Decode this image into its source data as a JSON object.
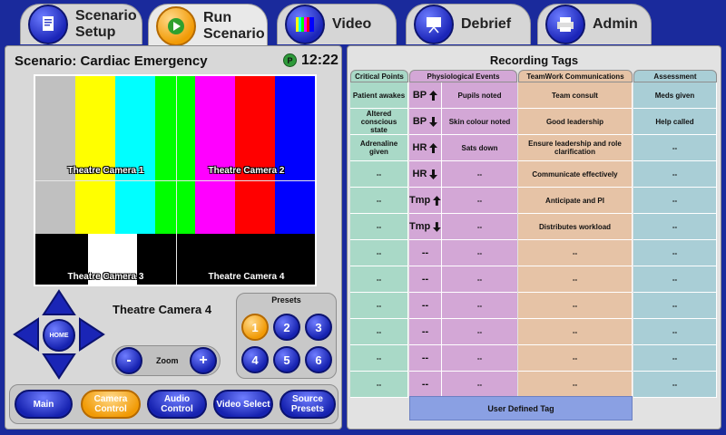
{
  "tabs": [
    {
      "line1": "Scenario",
      "line2": "Setup",
      "icon": "document-icon",
      "active": false
    },
    {
      "line1": "Run",
      "line2": "Scenario",
      "icon": "play-icon",
      "active": true
    },
    {
      "line1": "Video",
      "line2": "",
      "icon": "color-bars-icon",
      "active": false
    },
    {
      "line1": "Debrief",
      "line2": "",
      "icon": "projector-screen-icon",
      "active": false
    },
    {
      "line1": "Admin",
      "line2": "",
      "icon": "printer-icon",
      "active": false
    }
  ],
  "scenario": {
    "title": "Scenario: Cardiac Emergency",
    "badge": "P",
    "clock": "12:22"
  },
  "video": {
    "camera_labels": [
      "Theatre Camera 1",
      "Theatre Camera 2",
      "Theatre Camera 3",
      "Theatre Camera 4"
    ],
    "bar_colors": [
      "#c0c0c0",
      "#ffff00",
      "#00ffff",
      "#00ff00",
      "#ff00ff",
      "#ff0000",
      "#0000ff"
    ]
  },
  "controls": {
    "home_label": "HOME",
    "selected_camera": "Theatre Camera 4",
    "zoom_label": "Zoom",
    "zoom_minus": "-",
    "zoom_plus": "+",
    "presets_title": "Presets",
    "presets": [
      "1",
      "2",
      "3",
      "4",
      "5",
      "6"
    ],
    "active_preset": "1"
  },
  "bottom_nav": [
    {
      "label": "Main",
      "active": false
    },
    {
      "label": "Camera Control",
      "active": true
    },
    {
      "label": "Audio Control",
      "active": false
    },
    {
      "label": "Video Select",
      "active": false
    },
    {
      "label": "Source Presets",
      "active": false
    }
  ],
  "recording": {
    "title": "Recording Tags",
    "columns": {
      "critical": "Critical Points",
      "physio": "Physiological Events",
      "teamwork": "TeamWork Communications",
      "assessment": "Assessment"
    },
    "critical_points": [
      "Patient awakes",
      "Altered conscious state",
      "Adrenaline given",
      "--",
      "--",
      "--",
      "--",
      "--",
      "--",
      "--",
      "--",
      "--"
    ],
    "physio_left": [
      {
        "label": "BP",
        "arrow": "up"
      },
      {
        "label": "BP",
        "arrow": "down"
      },
      {
        "label": "HR",
        "arrow": "up"
      },
      {
        "label": "HR",
        "arrow": "down"
      },
      {
        "label": "Tmp",
        "arrow": "up"
      },
      {
        "label": "Tmp",
        "arrow": "down"
      },
      {
        "label": "--",
        "arrow": ""
      },
      {
        "label": "--",
        "arrow": ""
      },
      {
        "label": "--",
        "arrow": ""
      },
      {
        "label": "--",
        "arrow": ""
      },
      {
        "label": "--",
        "arrow": ""
      },
      {
        "label": "--",
        "arrow": ""
      }
    ],
    "physio_right": [
      "Pupils noted",
      "Skin colour noted",
      "Sats down",
      "--",
      "--",
      "--",
      "--",
      "--",
      "--",
      "--",
      "--",
      "--"
    ],
    "teamwork": [
      "Team consult",
      "Good leadership",
      "Ensure leadership and role clarification",
      "Communicate effectively",
      "Anticipate and PI",
      "Distributes workload",
      "--",
      "--",
      "--",
      "--",
      "--",
      "--"
    ],
    "assessment": [
      "Meds given",
      "Help called",
      "--",
      "--",
      "--",
      "--",
      "--",
      "--",
      "--",
      "--",
      "--",
      "--"
    ],
    "user_defined_tag": "User Defined Tag",
    "colors": {
      "critical": "#a9d9c7",
      "physio": "#d3a7d6",
      "teamwork": "#e6c3a6",
      "assessment": "#a9ced6"
    }
  }
}
